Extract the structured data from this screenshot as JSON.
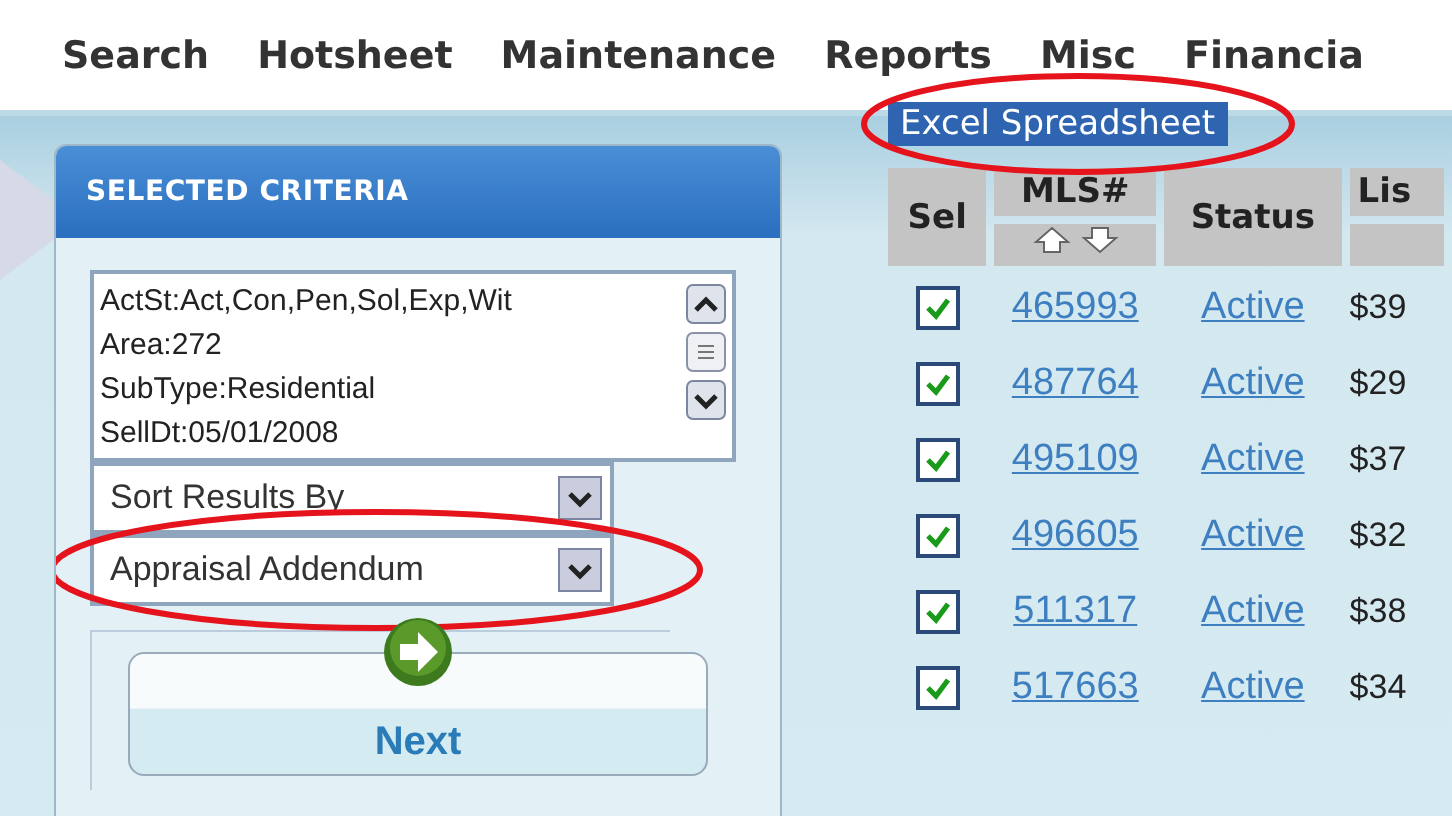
{
  "menu": [
    {
      "label": "Search"
    },
    {
      "label": "Hotsheet"
    },
    {
      "label": "Maintenance"
    },
    {
      "label": "Reports"
    },
    {
      "label": "Misc"
    },
    {
      "label": "Financia"
    }
  ],
  "submenu": {
    "label": "Excel Spreadsheet",
    "circled": true
  },
  "criteria_panel": {
    "title": "SELECTED CRITERIA",
    "criteria": [
      "ActSt:Act,Con,Pen,Sol,Exp,Wit",
      "Area:272",
      "SubType:Residential",
      "SellDt:05/01/2008"
    ],
    "sort_dropdown": {
      "value": "Sort Results By"
    },
    "report_dropdown": {
      "value": "Appraisal Addendum",
      "circled": true
    },
    "next_button": {
      "label": "Next"
    }
  },
  "table": {
    "columns": [
      "Sel",
      "MLS#",
      "Status",
      "Lis"
    ],
    "rows": [
      {
        "checked": true,
        "mls": "465993",
        "status": "Active",
        "price": "$39"
      },
      {
        "checked": true,
        "mls": "487764",
        "status": "Active",
        "price": "$29"
      },
      {
        "checked": true,
        "mls": "495109",
        "status": "Active",
        "price": "$37"
      },
      {
        "checked": true,
        "mls": "496605",
        "status": "Active",
        "price": "$32"
      },
      {
        "checked": true,
        "mls": "511317",
        "status": "Active",
        "price": "$38"
      },
      {
        "checked": true,
        "mls": "517663",
        "status": "Active",
        "price": "$34"
      }
    ]
  }
}
